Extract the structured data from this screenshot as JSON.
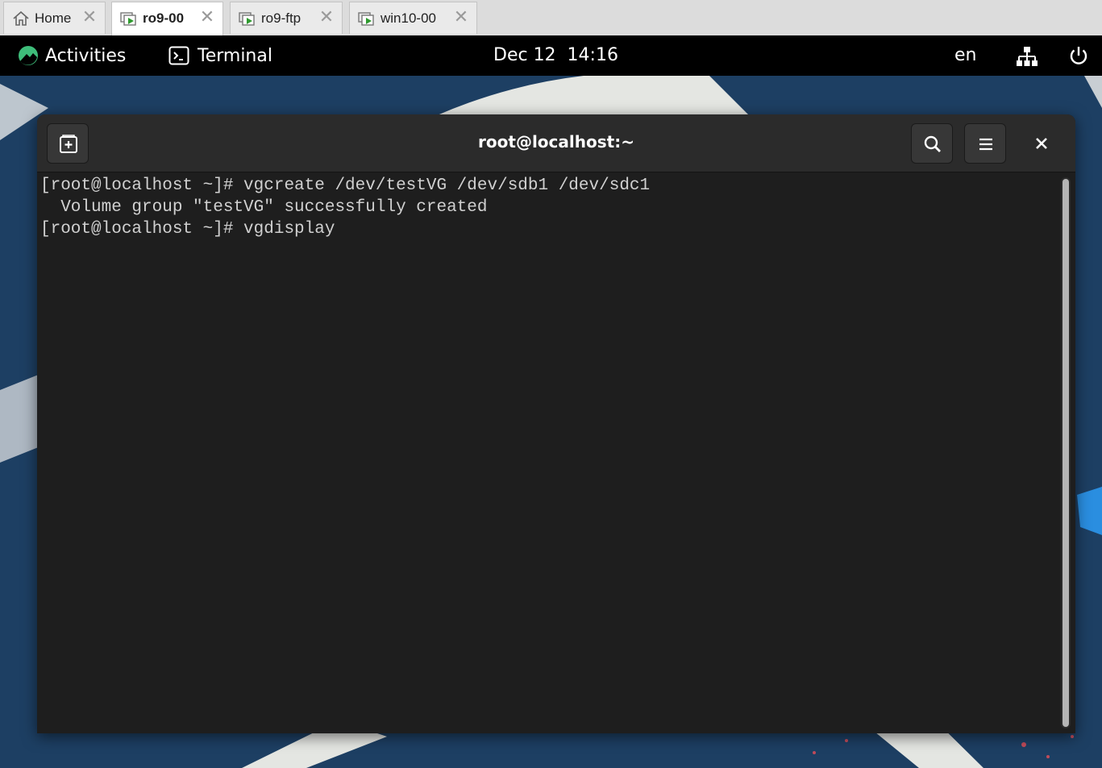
{
  "vm_tabs": [
    {
      "label": "Home",
      "icon": "home-icon",
      "active": false
    },
    {
      "label": "ro9-00",
      "icon": "vm-running-icon",
      "active": true
    },
    {
      "label": "ro9-ftp",
      "icon": "vm-running-icon",
      "active": false
    },
    {
      "label": "win10-00",
      "icon": "vm-running-icon",
      "active": false
    }
  ],
  "tab_close_glyph": "✕",
  "topbar": {
    "activities_label": "Activities",
    "app_label": "Terminal",
    "clock": "Dec 12  14:16",
    "language": "en"
  },
  "terminal": {
    "title": "root@localhost:~",
    "lines": [
      "[root@localhost ~]# vgcreate /dev/testVG /dev/sdb1 /dev/sdc1",
      "  Volume group \"testVG\" successfully created",
      "[root@localhost ~]# vgdisplay"
    ]
  },
  "colors": {
    "wallpaper": "#1d3f63",
    "topbar": "#000000",
    "headerbar": "#2b2b2b",
    "terminal_bg": "#1e1e1e",
    "terminal_fg": "#d0d0d0",
    "accent_green": "#3ebd7a"
  }
}
